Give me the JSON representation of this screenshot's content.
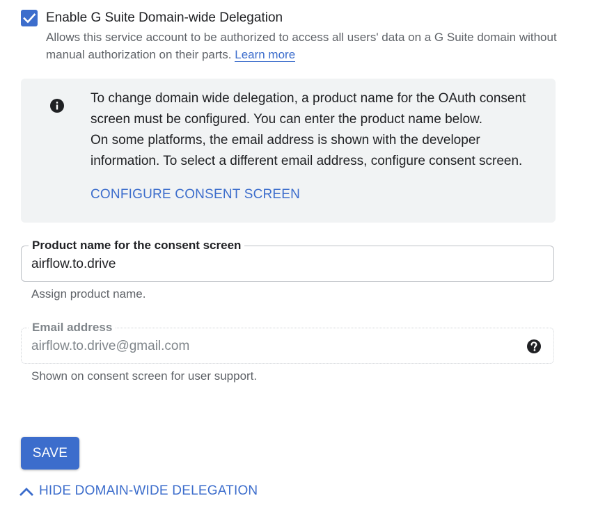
{
  "delegation": {
    "checkbox_checked": true,
    "label": "Enable G Suite Domain-wide Delegation",
    "description": "Allows this service account to be authorized to access all users' data on a G Suite domain without manual authorization on their parts.",
    "learn_more": "Learn more"
  },
  "info": {
    "icon": "info-icon",
    "line1": "To change domain wide delegation, a product name for the OAuth consent screen must be configured. You can enter the product name below.",
    "line2": "On some platforms, the email address is shown with the developer information. To select a different email address, configure consent screen.",
    "configure_button": "CONFIGURE CONSENT SCREEN"
  },
  "product_field": {
    "label": "Product name for the consent screen",
    "value": "airflow.to.drive",
    "helper": "Assign product name."
  },
  "email_field": {
    "label": "Email address",
    "value": "airflow.to.drive@gmail.com",
    "helper": "Shown on consent screen for user support.",
    "icon": "help-icon"
  },
  "save_button": "SAVE",
  "hide_toggle": {
    "label": "HIDE DOMAIN-WIDE DELEGATION",
    "icon": "chevron-up-icon"
  },
  "colors": {
    "accent": "#3c6dcc",
    "panel_bg": "#f1f3f4",
    "secondary_text": "#5f6368"
  }
}
